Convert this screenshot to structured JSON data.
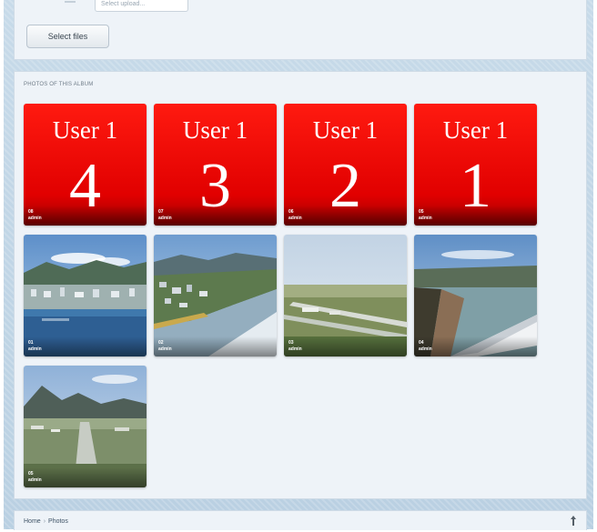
{
  "upload": {
    "select_files_label": "Select files",
    "partial_select_value": "Select upload..."
  },
  "album": {
    "section_title": "PHOTOS OF THIS ALBUM",
    "photos": [
      {
        "kind": "placeholder",
        "user_text": "User 1",
        "big_number": "4",
        "caption_number": "08",
        "author": "admin"
      },
      {
        "kind": "placeholder",
        "user_text": "User 1",
        "big_number": "3",
        "caption_number": "07",
        "author": "admin"
      },
      {
        "kind": "placeholder",
        "user_text": "User 1",
        "big_number": "2",
        "caption_number": "06",
        "author": "admin"
      },
      {
        "kind": "placeholder",
        "user_text": "User 1",
        "big_number": "1",
        "caption_number": "05",
        "author": "admin"
      },
      {
        "kind": "photo",
        "scene": "coastal city aerial",
        "caption_number": "01",
        "author": "admin"
      },
      {
        "kind": "photo",
        "scene": "city and river aerial",
        "caption_number": "02",
        "author": "admin"
      },
      {
        "kind": "photo",
        "scene": "airport runway aerial",
        "caption_number": "03",
        "author": "admin"
      },
      {
        "kind": "photo",
        "scene": "coast from airplane window",
        "caption_number": "04",
        "author": "admin"
      },
      {
        "kind": "photo",
        "scene": "mountains and runway aerial",
        "caption_number": "05",
        "author": "admin"
      }
    ]
  },
  "breadcrumb": {
    "home": "Home",
    "separator": "›",
    "current": "Photos"
  },
  "colors": {
    "placeholder_red": "#e10000",
    "panel_background": "#eef3f8",
    "frame_background": "#c7dae9"
  },
  "icons": {
    "scroll_top": "chevron-up-icon"
  }
}
